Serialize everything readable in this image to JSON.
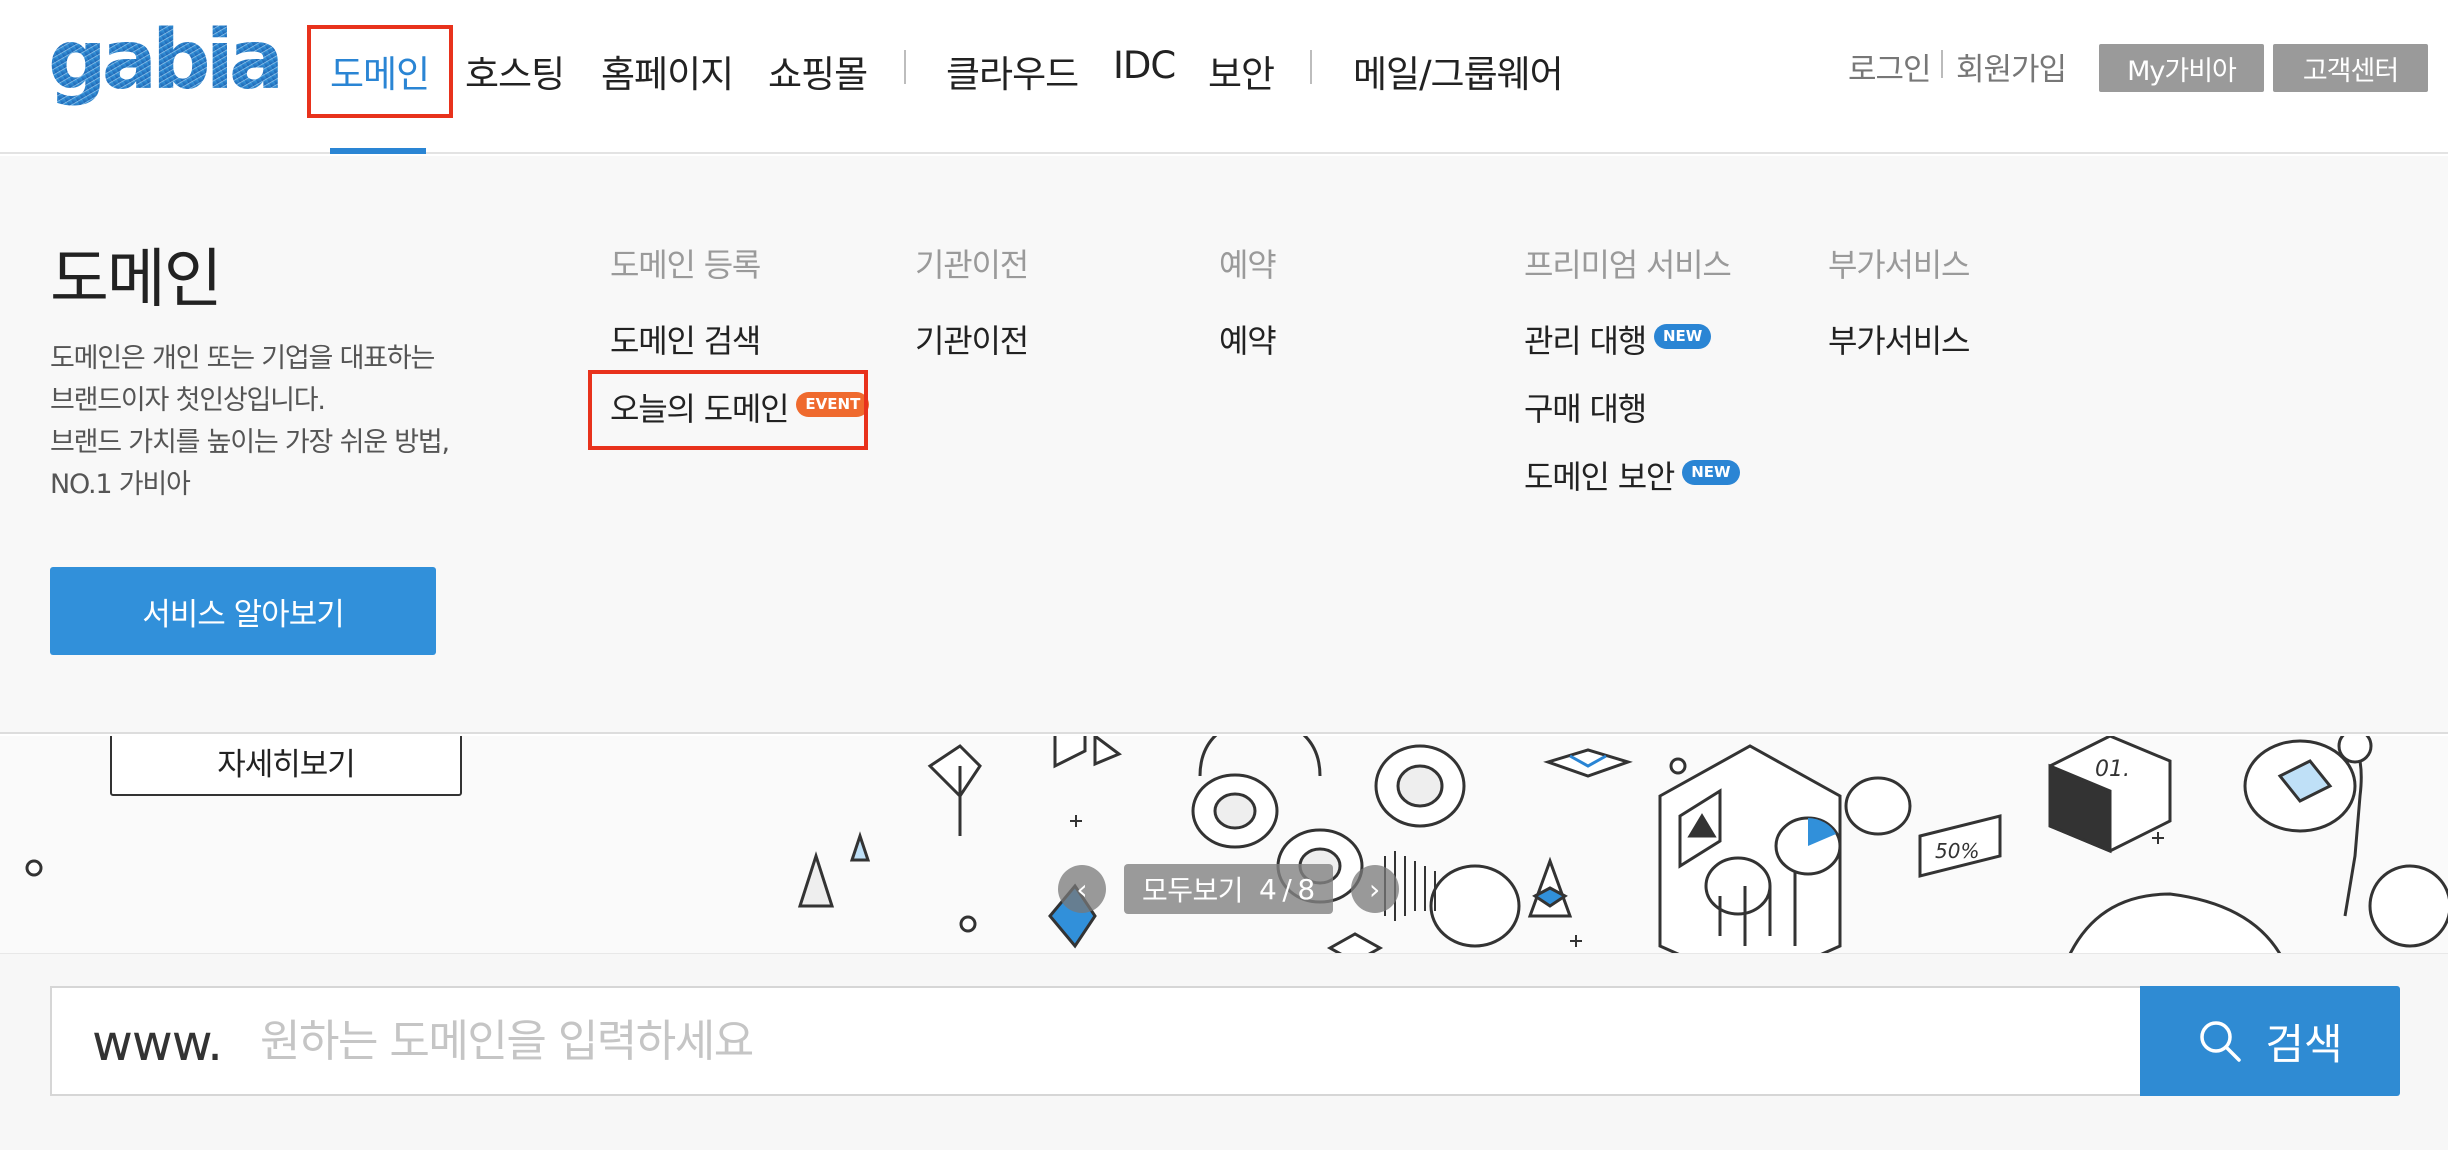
{
  "header": {
    "logo_text": "gabia.",
    "nav": [
      {
        "label": "도메인",
        "active": true
      },
      {
        "label": "호스팅"
      },
      {
        "label": "홈페이지"
      },
      {
        "label": "쇼핑몰"
      },
      {
        "label": "클라우드"
      },
      {
        "label": "IDC"
      },
      {
        "label": "보안"
      },
      {
        "label": "메일/그룹웨어"
      }
    ],
    "login": "로그인",
    "signup": "회원가입",
    "my_gabia": "My가비아",
    "customer_center": "고객센터",
    "accent_color": "#2a85d4",
    "highlight_color": "#e8321c"
  },
  "mega_menu": {
    "title": "도메인",
    "description": [
      "도메인은 개인 또는 기업을 대표하는",
      "브랜드이자 첫인상입니다.",
      "브랜드 가치를 높이는 가장 쉬운 방법,",
      "NO.1 가비아"
    ],
    "service_button": "서비스 알아보기",
    "columns": [
      {
        "heading": "도메인 등록",
        "items": [
          {
            "label": "도메인 검색"
          },
          {
            "label": "오늘의 도메인",
            "badge": "EVENT"
          }
        ]
      },
      {
        "heading": "기관이전",
        "items": [
          {
            "label": "기관이전"
          }
        ]
      },
      {
        "heading": "예약",
        "items": [
          {
            "label": "예약"
          }
        ]
      },
      {
        "heading": "프리미엄 서비스",
        "items": [
          {
            "label": "관리 대행",
            "badge": "NEW"
          },
          {
            "label": "구매 대행"
          },
          {
            "label": "도메인 보안",
            "badge": "NEW"
          }
        ]
      },
      {
        "heading": "부가서비스",
        "items": [
          {
            "label": "부가서비스"
          }
        ]
      }
    ]
  },
  "banner": {
    "detail_button": "자세히보기",
    "pager": {
      "view_all": "모두보기",
      "current": "4",
      "total": "8",
      "separator": "/"
    }
  },
  "search": {
    "prefix": "www.",
    "placeholder": "원하는 도메인을 입력하세요",
    "value": "",
    "button_label": "검색"
  }
}
